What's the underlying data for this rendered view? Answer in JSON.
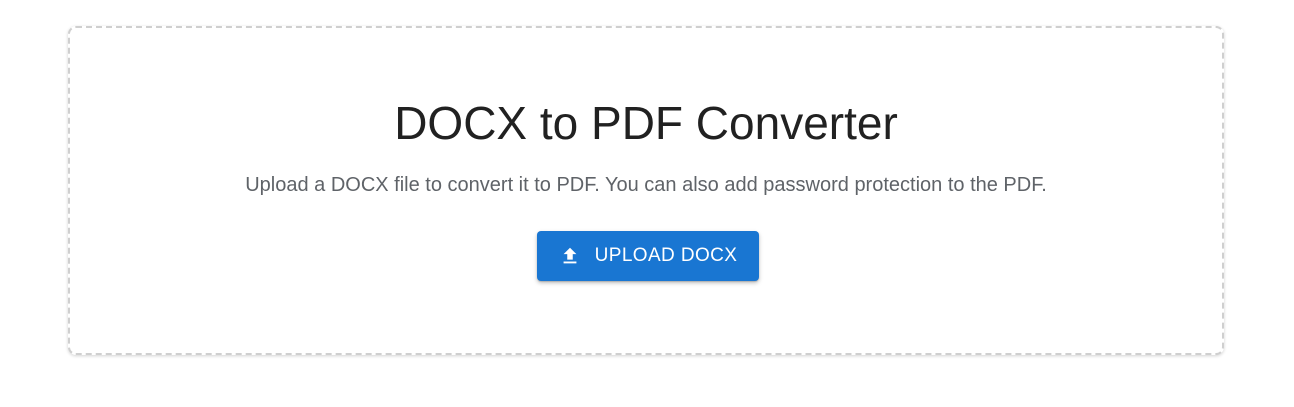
{
  "converter": {
    "title": "DOCX to PDF Converter",
    "description": "Upload a DOCX file to convert it to PDF. You can also add password protection to the PDF.",
    "upload_button": {
      "label": "UPLOAD DOCX",
      "icon": "upload-icon"
    }
  },
  "colors": {
    "primary": "#1976d2",
    "border": "#cfcfcf",
    "title_text": "#212121",
    "body_text": "#5f6368"
  }
}
